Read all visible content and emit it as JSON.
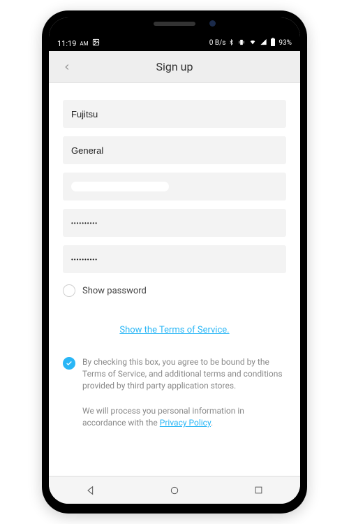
{
  "statusBar": {
    "time": "11:19",
    "amPm": "AM",
    "network": "0 B/s",
    "battery": "93%"
  },
  "appBar": {
    "title": "Sign up"
  },
  "form": {
    "field1": "Fujitsu",
    "field2": "General",
    "field3": "",
    "field4": "••••••••••",
    "field5": "••••••••••",
    "showPassword": "Show password"
  },
  "links": {
    "tos": "Show the Terms of Service.",
    "privacy": "Privacy Policy"
  },
  "text": {
    "agree": "By checking this box, you agree to be bound by the Terms of Service, and additional terms and conditions provided by third party application stores.",
    "privacyPrefix": "We will process you personal information in accordance with the ",
    "privacySuffix": "."
  }
}
